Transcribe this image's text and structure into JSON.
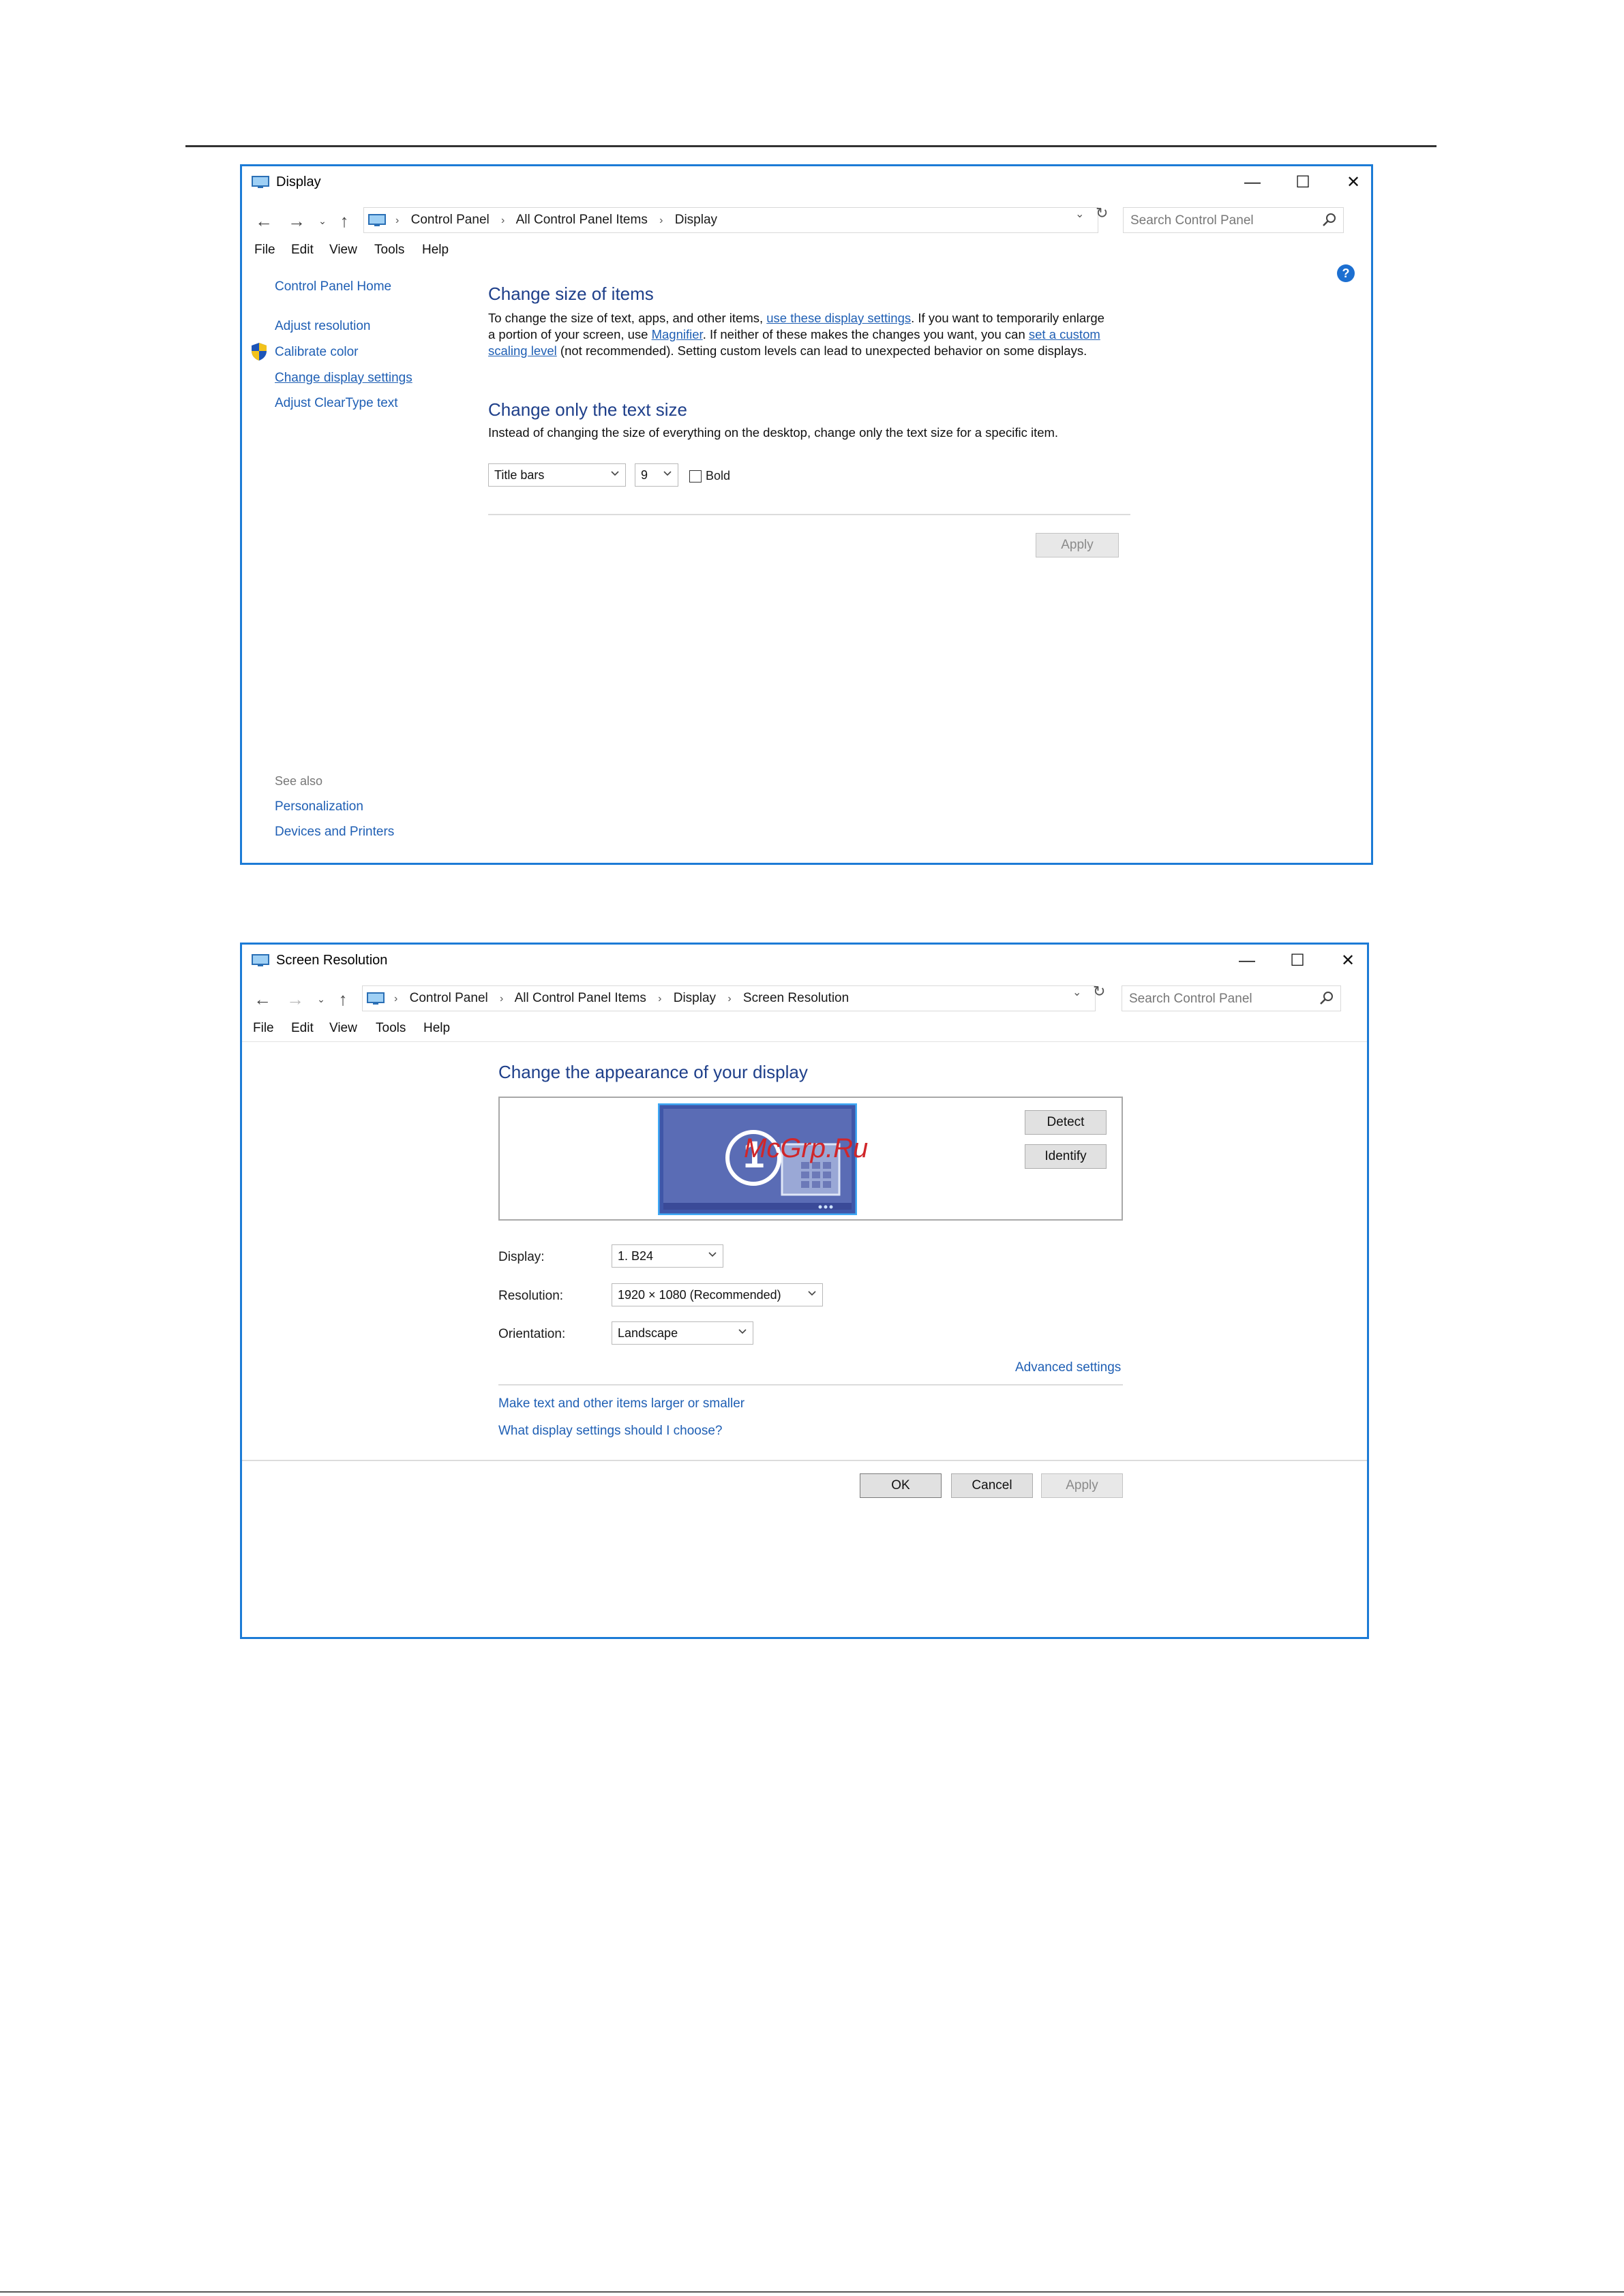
{
  "display_window": {
    "title": "Display",
    "breadcrumbs": [
      "Control Panel",
      "All Control Panel Items",
      "Display"
    ],
    "search_placeholder": "Search Control Panel",
    "menu": [
      "File",
      "Edit",
      "View",
      "Tools",
      "Help"
    ],
    "sidebar": {
      "home": "Control Panel Home",
      "items": [
        "Adjust resolution",
        "Calibrate color",
        "Change display settings",
        "Adjust ClearType text"
      ],
      "see_also_label": "See also",
      "see_also": [
        "Personalization",
        "Devices and Printers"
      ]
    },
    "section1": {
      "heading": "Change size of items",
      "text_a": "To change the size of text, apps, and other items, ",
      "link_a": "use these display settings",
      "text_b": ".  If you want to temporarily enlarge",
      "text_c": "a portion of your screen, use ",
      "link_b": "Magnifier",
      "text_d": ".  If neither of these makes the changes you want, you can ",
      "link_c1": "set a custom",
      "link_c2": "scaling level",
      "text_e": " (not recommended).  Setting custom levels can lead to unexpected behavior on some displays."
    },
    "section2": {
      "heading": "Change only the text size",
      "text": "Instead of changing the size of everything on the desktop, change only the text size for a specific item.",
      "item_select": "Title bars",
      "size_select": "9",
      "bold_label": "Bold",
      "apply": "Apply"
    }
  },
  "resolution_window": {
    "title": "Screen Resolution",
    "breadcrumbs": [
      "Control Panel",
      "All Control Panel Items",
      "Display",
      "Screen Resolution"
    ],
    "search_placeholder": "Search Control Panel",
    "menu": [
      "File",
      "Edit",
      "View",
      "Tools",
      "Help"
    ],
    "heading": "Change the appearance of your display",
    "monitor_number": "1",
    "watermark": "McGrp.Ru",
    "detect": "Detect",
    "identify": "Identify",
    "fields": {
      "display_label": "Display:",
      "display_value": "1. B24",
      "resolution_label": "Resolution:",
      "resolution_value": "1920 × 1080 (Recommended)",
      "orientation_label": "Orientation:",
      "orientation_value": "Landscape"
    },
    "advanced": "Advanced settings",
    "link1": "Make text and other items larger or smaller",
    "link2": "What display settings should I choose?",
    "ok": "OK",
    "cancel": "Cancel",
    "apply": "Apply"
  },
  "colors": {
    "accent": "#1c7bd6",
    "link": "#1f5fb4",
    "heading": "#1e3f8a"
  }
}
